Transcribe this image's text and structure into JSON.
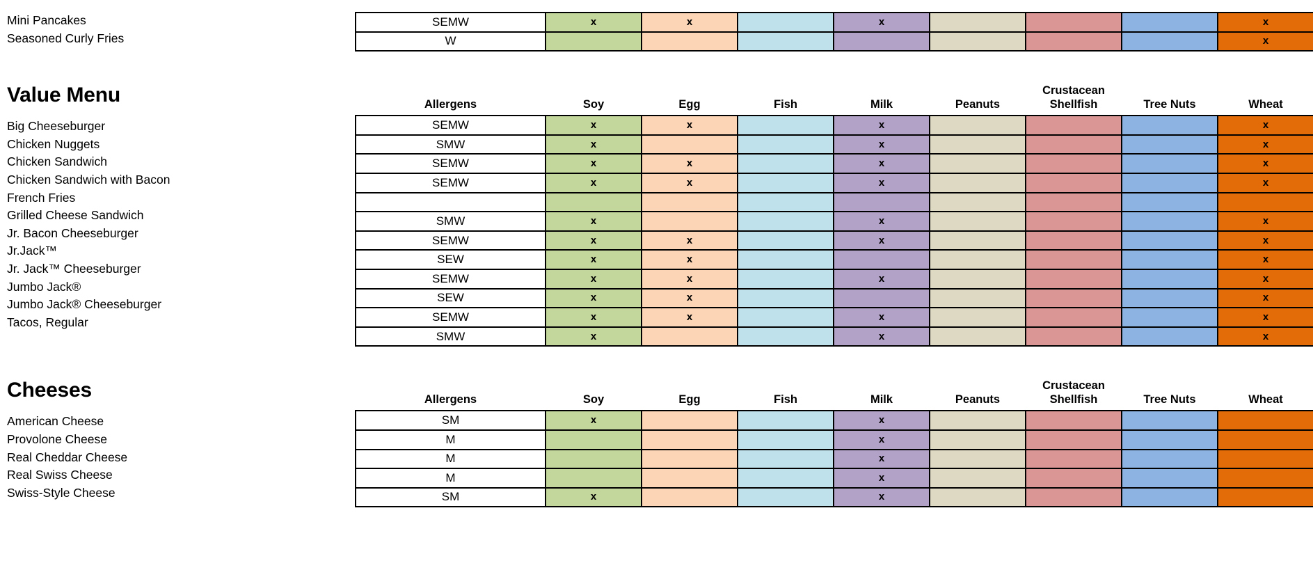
{
  "columns": {
    "allergens_label": "Allergens",
    "soy": "Soy",
    "egg": "Egg",
    "fish": "Fish",
    "milk": "Milk",
    "peanuts": "Peanuts",
    "shellfish_top": "Crustacean",
    "shellfish": "Shellfish",
    "tree_nuts": "Tree Nuts",
    "wheat": "Wheat"
  },
  "colors": {
    "soy": "#c3d69b",
    "egg": "#fbd5b5",
    "fish": "#bfe1eb",
    "milk": "#b3a2c7",
    "peanuts": "#ddd9c3",
    "shellfish": "#d99694",
    "tree_nuts": "#8db3e2",
    "wheat": "#e36c09",
    "code_cell": "#ffffff",
    "border": "#000000",
    "text": "#000000"
  },
  "mark": "x",
  "sections": [
    {
      "title": "",
      "show_header": false,
      "rows": [
        {
          "name": "Mini Pancakes",
          "code": "SEMW",
          "marks": {
            "soy": true,
            "egg": true,
            "fish": false,
            "milk": true,
            "peanuts": false,
            "shellfish": false,
            "tree_nuts": false,
            "wheat": true
          }
        },
        {
          "name": "Seasoned Curly Fries",
          "code": "W",
          "marks": {
            "soy": false,
            "egg": false,
            "fish": false,
            "milk": false,
            "peanuts": false,
            "shellfish": false,
            "tree_nuts": false,
            "wheat": true
          }
        }
      ]
    },
    {
      "title": "Value Menu",
      "show_header": true,
      "rows": [
        {
          "name": "Big Cheeseburger",
          "code": "SEMW",
          "marks": {
            "soy": true,
            "egg": true,
            "fish": false,
            "milk": true,
            "peanuts": false,
            "shellfish": false,
            "tree_nuts": false,
            "wheat": true
          }
        },
        {
          "name": "Chicken Nuggets",
          "code": "SMW",
          "marks": {
            "soy": true,
            "egg": false,
            "fish": false,
            "milk": true,
            "peanuts": false,
            "shellfish": false,
            "tree_nuts": false,
            "wheat": true
          }
        },
        {
          "name": "Chicken Sandwich",
          "code": "SEMW",
          "marks": {
            "soy": true,
            "egg": true,
            "fish": false,
            "milk": true,
            "peanuts": false,
            "shellfish": false,
            "tree_nuts": false,
            "wheat": true
          }
        },
        {
          "name": "Chicken Sandwich with Bacon",
          "code": "SEMW",
          "marks": {
            "soy": true,
            "egg": true,
            "fish": false,
            "milk": true,
            "peanuts": false,
            "shellfish": false,
            "tree_nuts": false,
            "wheat": true
          }
        },
        {
          "name": "French Fries",
          "code": "",
          "marks": {
            "soy": false,
            "egg": false,
            "fish": false,
            "milk": false,
            "peanuts": false,
            "shellfish": false,
            "tree_nuts": false,
            "wheat": false
          }
        },
        {
          "name": "Grilled Cheese Sandwich",
          "code": "SMW",
          "marks": {
            "soy": true,
            "egg": false,
            "fish": false,
            "milk": true,
            "peanuts": false,
            "shellfish": false,
            "tree_nuts": false,
            "wheat": true
          }
        },
        {
          "name": "Jr. Bacon Cheeseburger",
          "code": "SEMW",
          "marks": {
            "soy": true,
            "egg": true,
            "fish": false,
            "milk": true,
            "peanuts": false,
            "shellfish": false,
            "tree_nuts": false,
            "wheat": true
          }
        },
        {
          "name": "Jr.Jack™",
          "code": "SEW",
          "marks": {
            "soy": true,
            "egg": true,
            "fish": false,
            "milk": false,
            "peanuts": false,
            "shellfish": false,
            "tree_nuts": false,
            "wheat": true
          }
        },
        {
          "name": "Jr. Jack™ Cheeseburger",
          "code": "SEMW",
          "marks": {
            "soy": true,
            "egg": true,
            "fish": false,
            "milk": true,
            "peanuts": false,
            "shellfish": false,
            "tree_nuts": false,
            "wheat": true
          }
        },
        {
          "name": "Jumbo Jack®",
          "code": "SEW",
          "marks": {
            "soy": true,
            "egg": true,
            "fish": false,
            "milk": false,
            "peanuts": false,
            "shellfish": false,
            "tree_nuts": false,
            "wheat": true
          }
        },
        {
          "name": "Jumbo Jack® Cheeseburger",
          "code": "SEMW",
          "marks": {
            "soy": true,
            "egg": true,
            "fish": false,
            "milk": true,
            "peanuts": false,
            "shellfish": false,
            "tree_nuts": false,
            "wheat": true
          }
        },
        {
          "name": "Tacos, Regular",
          "code": "SMW",
          "marks": {
            "soy": true,
            "egg": false,
            "fish": false,
            "milk": true,
            "peanuts": false,
            "shellfish": false,
            "tree_nuts": false,
            "wheat": true
          }
        }
      ]
    },
    {
      "title": "Cheeses",
      "show_header": true,
      "rows": [
        {
          "name": "American Cheese",
          "code": "SM",
          "marks": {
            "soy": true,
            "egg": false,
            "fish": false,
            "milk": true,
            "peanuts": false,
            "shellfish": false,
            "tree_nuts": false,
            "wheat": false
          }
        },
        {
          "name": "Provolone Cheese",
          "code": "M",
          "marks": {
            "soy": false,
            "egg": false,
            "fish": false,
            "milk": true,
            "peanuts": false,
            "shellfish": false,
            "tree_nuts": false,
            "wheat": false
          }
        },
        {
          "name": "Real Cheddar Cheese",
          "code": "M",
          "marks": {
            "soy": false,
            "egg": false,
            "fish": false,
            "milk": true,
            "peanuts": false,
            "shellfish": false,
            "tree_nuts": false,
            "wheat": false
          }
        },
        {
          "name": "Real Swiss Cheese",
          "code": "M",
          "marks": {
            "soy": false,
            "egg": false,
            "fish": false,
            "milk": true,
            "peanuts": false,
            "shellfish": false,
            "tree_nuts": false,
            "wheat": false
          }
        },
        {
          "name": "Swiss-Style Cheese",
          "code": "SM",
          "marks": {
            "soy": true,
            "egg": false,
            "fish": false,
            "milk": true,
            "peanuts": false,
            "shellfish": false,
            "tree_nuts": false,
            "wheat": false
          }
        }
      ]
    }
  ]
}
